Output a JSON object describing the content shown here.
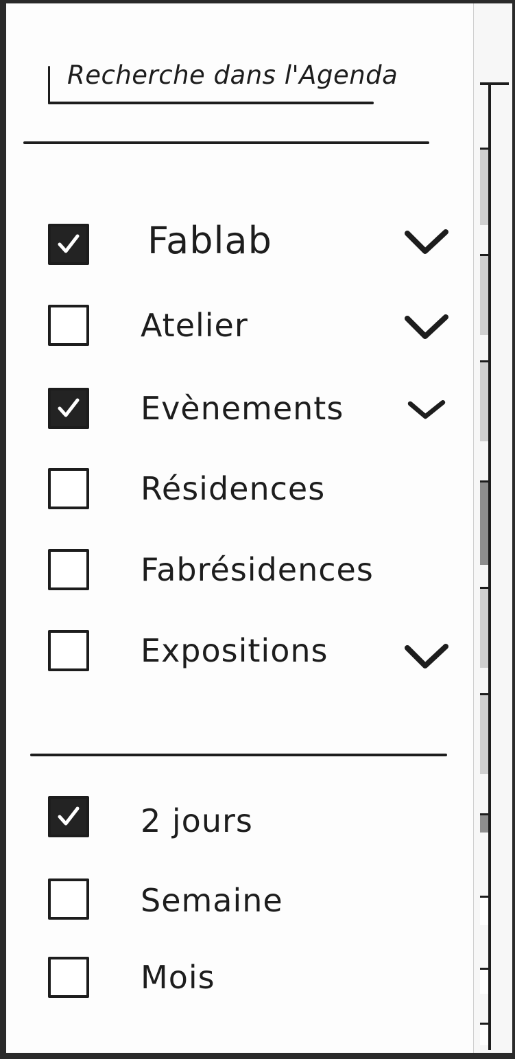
{
  "panel": {
    "title": "Recherche dans l'Agenda"
  },
  "categories": [
    {
      "label": "Fablab",
      "checked": true,
      "expand_icon": "chevron-down-icon",
      "has_chevron": true
    },
    {
      "label": "Atelier",
      "checked": false,
      "expand_icon": "chevron-down-icon",
      "has_chevron": true
    },
    {
      "label": "Evènements",
      "checked": true,
      "expand_icon": "chevron-down-icon",
      "has_chevron": true
    },
    {
      "label": "Résidences",
      "checked": false,
      "has_chevron": false
    },
    {
      "label": "Fabrésidences",
      "checked": false,
      "has_chevron": false
    },
    {
      "label": "Expositions",
      "checked": false,
      "expand_icon": "chevron-down-icon",
      "has_chevron": true
    }
  ],
  "periods": [
    {
      "label": "2 jours",
      "checked": true
    },
    {
      "label": "Semaine",
      "checked": false
    },
    {
      "label": "Mois",
      "checked": false
    }
  ],
  "colors": {
    "ink": "#1d1d1d",
    "checkbox_fill_checked": "#232323",
    "scroll_segment_light": "#cfcfcf",
    "scroll_segment_dark": "#8e8e8e"
  }
}
